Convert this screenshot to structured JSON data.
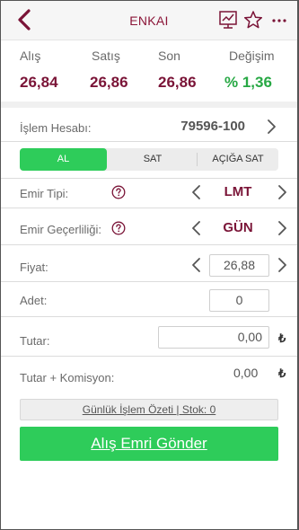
{
  "header": {
    "title": "ENKAI",
    "icons": [
      "back-icon",
      "chart-icon",
      "star-icon",
      "more-icon"
    ]
  },
  "quote": {
    "buy_label": "Alış",
    "buy_value": "26,84",
    "sell_label": "Satış",
    "sell_value": "26,86",
    "last_label": "Son",
    "last_value": "26,86",
    "change_label": "Değişim",
    "change_value": "% 1,36"
  },
  "account": {
    "label": "İşlem Hesabı:",
    "value": "79596-100"
  },
  "tabs": {
    "buy": "AL",
    "sell": "SAT",
    "short_sell": "AÇIĞA SAT",
    "active": "buy"
  },
  "order_type": {
    "label": "Emir Tipi:",
    "value": "LMT"
  },
  "order_validity": {
    "label": "Emir Geçerliliği:",
    "value": "GÜN"
  },
  "price": {
    "label": "Fiyat:",
    "value": "26,88"
  },
  "quantity": {
    "label": "Adet:",
    "value": "0"
  },
  "amount": {
    "label": "Tutar:",
    "value": "0,00",
    "currency": "₺"
  },
  "amount_commission": {
    "label": "Tutar + Komisyon:",
    "value": "0,00",
    "currency": "₺"
  },
  "summary_link": "Günlük İşlem Özeti | Stok: 0",
  "submit_label": "Alış Emri Gönder",
  "colors": {
    "accent_green": "#2ecc5a",
    "value_maroon": "#7a1437",
    "positive_green": "#27a844"
  }
}
